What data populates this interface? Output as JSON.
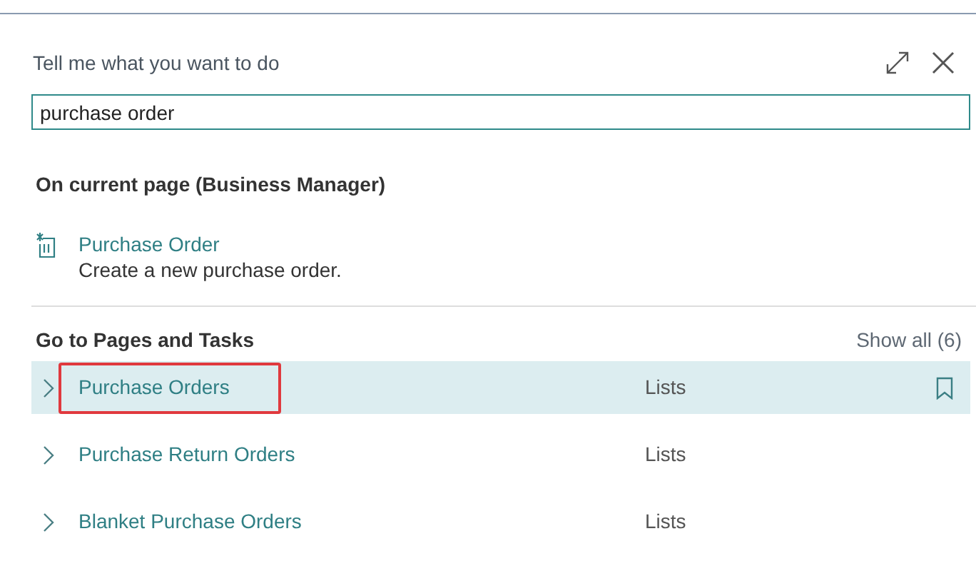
{
  "dialog": {
    "title": "Tell me what you want to do"
  },
  "search": {
    "value": "purchase order"
  },
  "current_page": {
    "heading": "On current page (Business Manager)",
    "actions": [
      {
        "title": "Purchase Order",
        "description": "Create a new purchase order."
      }
    ]
  },
  "pages_and_tasks": {
    "heading": "Go to Pages and Tasks",
    "show_all": "Show all (6)",
    "rows": [
      {
        "name": "Purchase Orders",
        "category": "Lists",
        "selected": true,
        "highlighted": true
      },
      {
        "name": "Purchase Return Orders",
        "category": "Lists",
        "selected": false,
        "highlighted": false
      },
      {
        "name": "Blanket Purchase Orders",
        "category": "Lists",
        "selected": false,
        "highlighted": false
      }
    ]
  }
}
